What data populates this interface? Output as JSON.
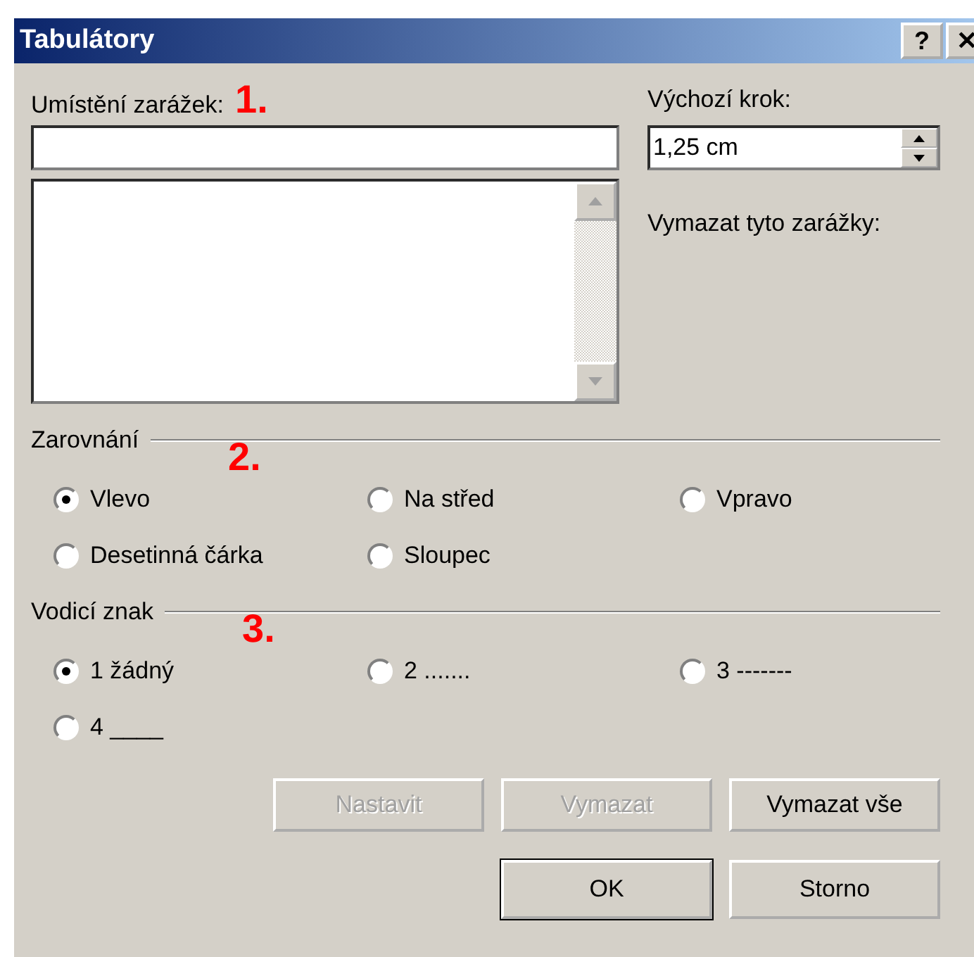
{
  "window": {
    "title": "Tabulátory",
    "help_button": "?",
    "close_button": "✕"
  },
  "tab_position": {
    "label": "Umístění zarážek:",
    "annotation": "1."
  },
  "default_step": {
    "label": "Výchozí krok:",
    "value": "1,25 cm"
  },
  "clear_label": "Vymazat tyto zarážky:",
  "alignment": {
    "title": "Zarovnání",
    "annotation": "2.",
    "options": [
      {
        "label": "Vlevo",
        "selected": true
      },
      {
        "label": "Na střed",
        "selected": false
      },
      {
        "label": "Vpravo",
        "selected": false
      },
      {
        "label": "Desetinná čárka",
        "selected": false
      },
      {
        "label": "Sloupec",
        "selected": false
      }
    ]
  },
  "leader": {
    "title": "Vodicí znak",
    "annotation": "3.",
    "options": [
      {
        "label": "1 žádný",
        "selected": true
      },
      {
        "label": "2 .......",
        "selected": false
      },
      {
        "label": "3 -------",
        "selected": false
      },
      {
        "label": "4 ____",
        "selected": false
      }
    ]
  },
  "action_buttons": [
    {
      "label": "Nastavit",
      "disabled": true
    },
    {
      "label": "Vymazat",
      "disabled": true
    },
    {
      "label": "Vymazat vše",
      "disabled": false
    }
  ],
  "dialog_buttons": [
    {
      "label": "OK",
      "default": true
    },
    {
      "label": "Storno",
      "default": false
    }
  ]
}
